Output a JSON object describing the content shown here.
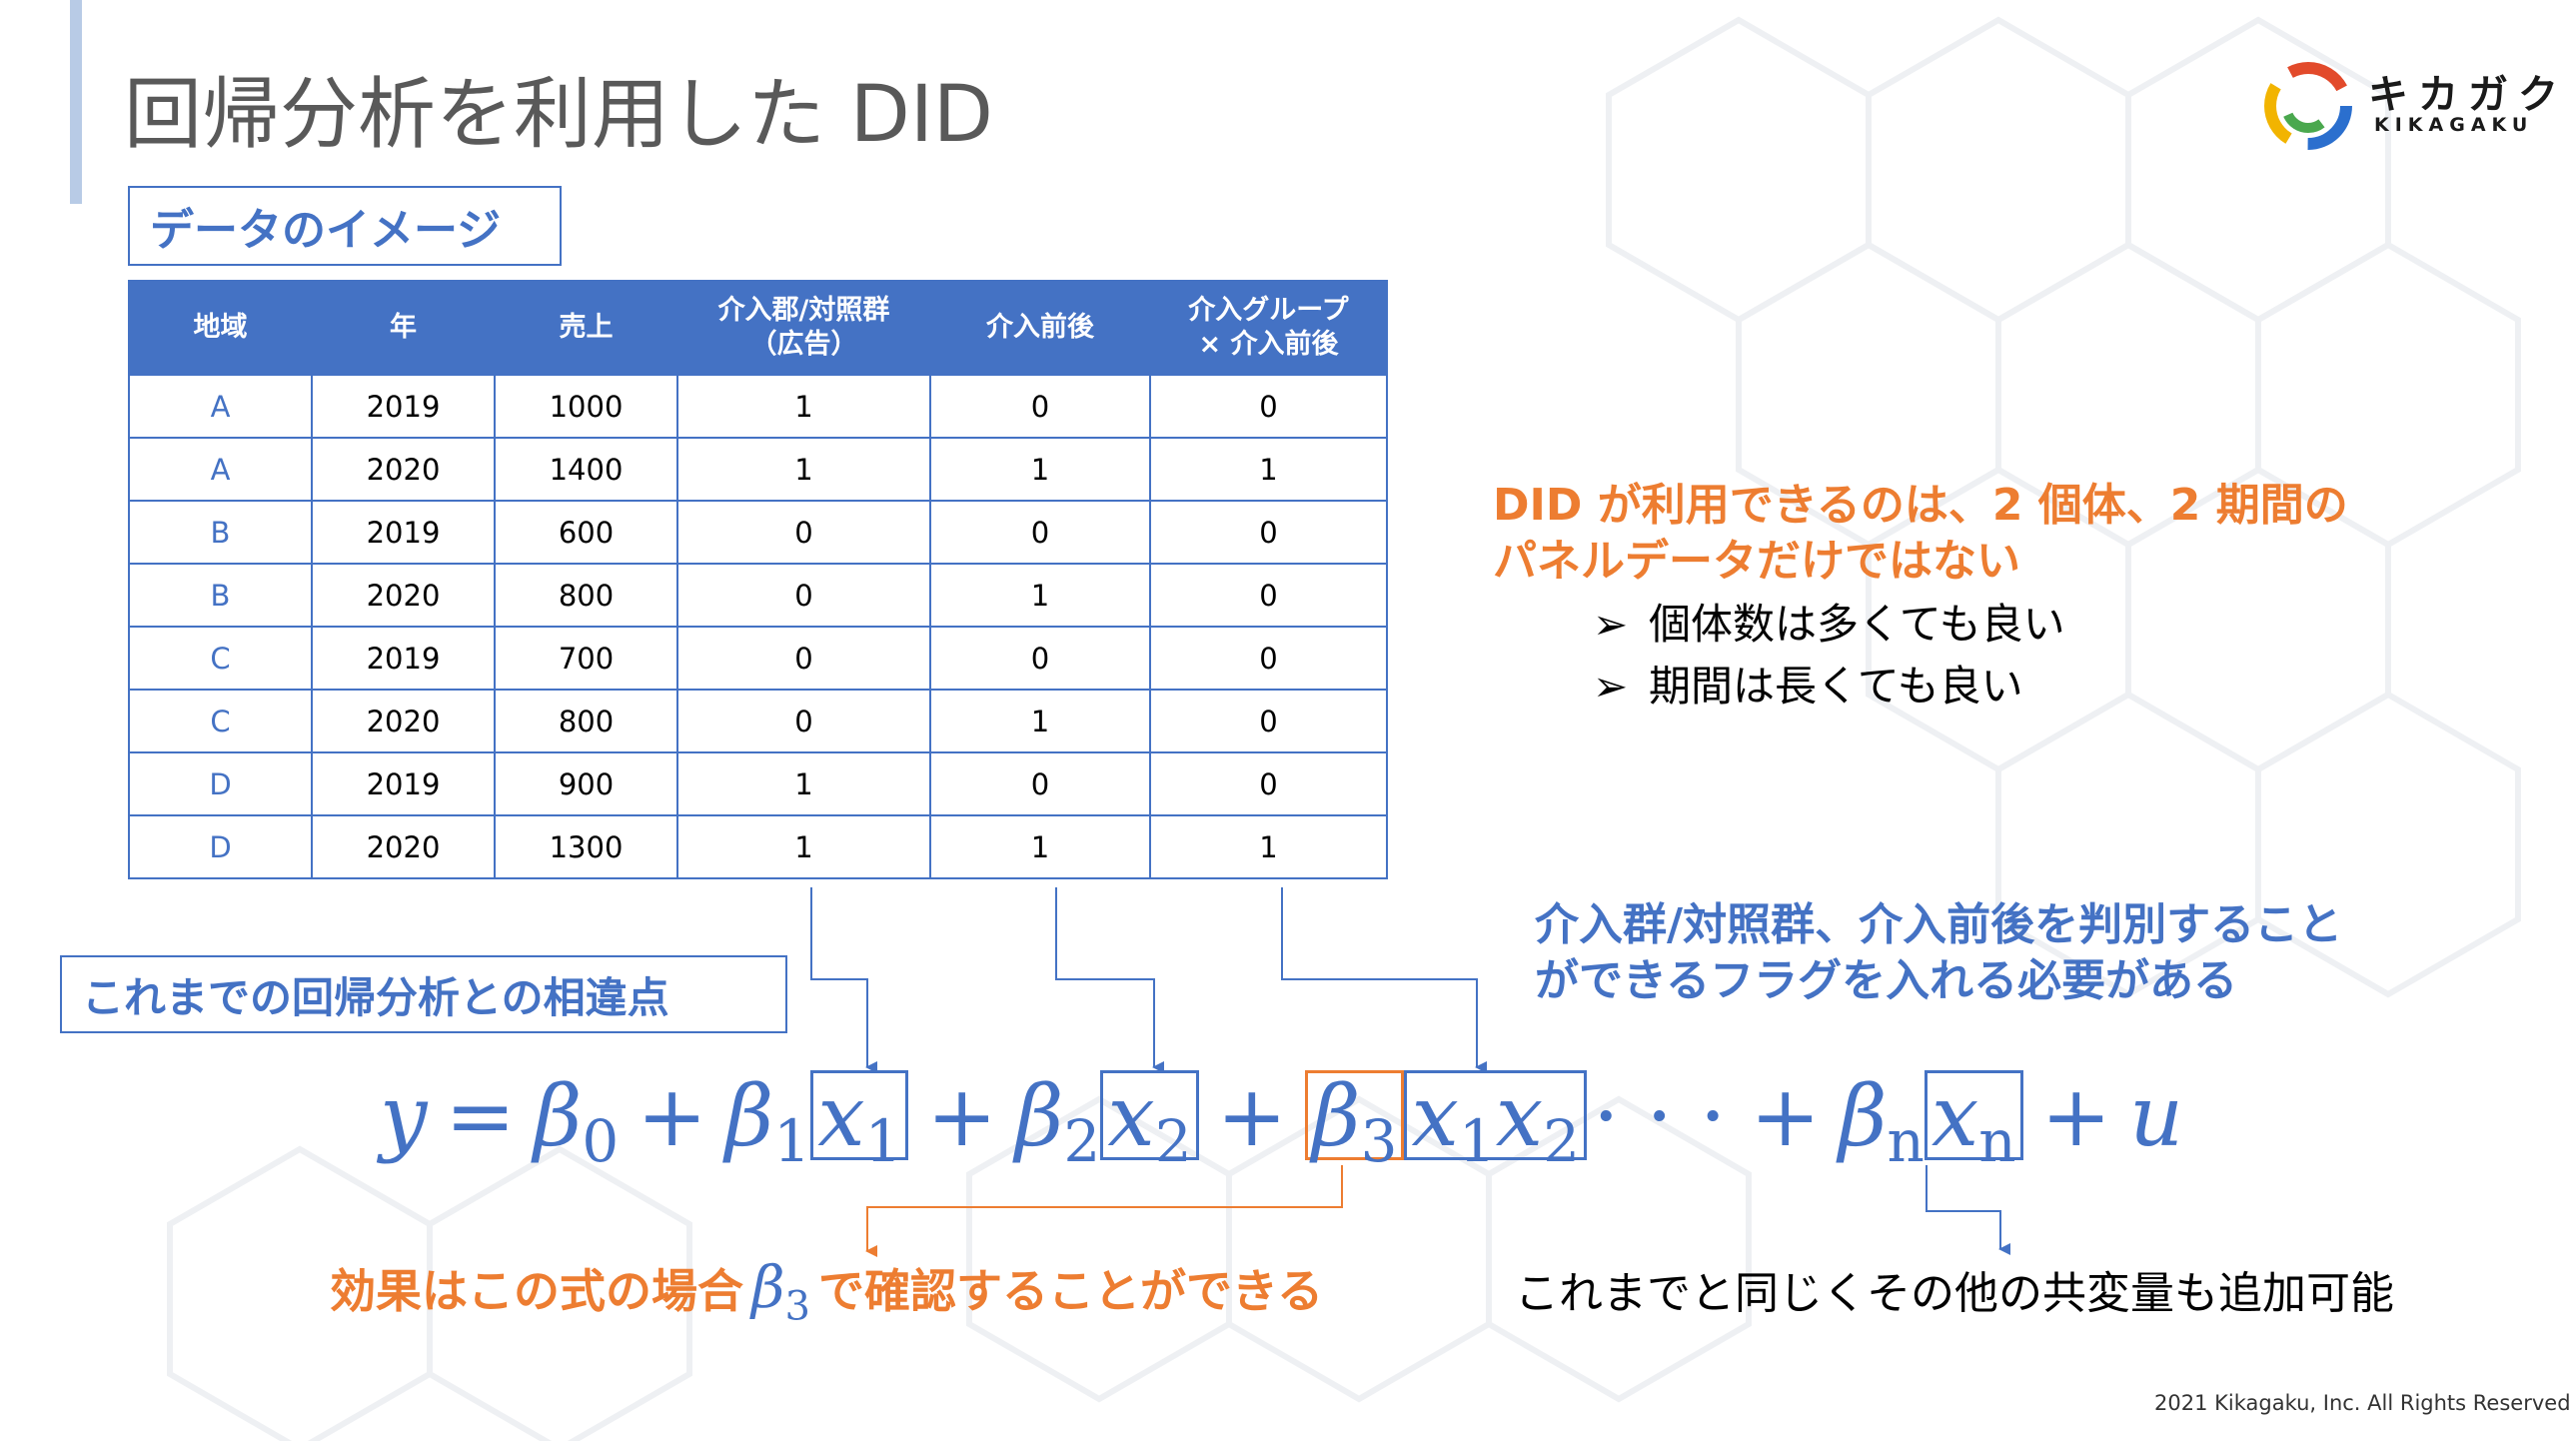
{
  "title": "回帰分析を利用した DID",
  "logo": {
    "jp": "キカガク",
    "en": "KIKAGAKU"
  },
  "data_label": "データのイメージ",
  "table": {
    "headers": [
      "地域",
      "年",
      "売上",
      "介入郡/対照群\n（広告）",
      "介入前後",
      "介入グループ\n× 介入前後"
    ],
    "rows": [
      [
        "A",
        "2019",
        "1000",
        "1",
        "0",
        "0"
      ],
      [
        "A",
        "2020",
        "1400",
        "1",
        "1",
        "1"
      ],
      [
        "B",
        "2019",
        "600",
        "0",
        "0",
        "0"
      ],
      [
        "B",
        "2020",
        "800",
        "0",
        "1",
        "0"
      ],
      [
        "C",
        "2019",
        "700",
        "0",
        "0",
        "0"
      ],
      [
        "C",
        "2020",
        "800",
        "0",
        "1",
        "0"
      ],
      [
        "D",
        "2019",
        "900",
        "1",
        "0",
        "0"
      ],
      [
        "D",
        "2020",
        "1300",
        "1",
        "1",
        "1"
      ]
    ]
  },
  "did_note": {
    "line1": "DID が利用できるのは、2 個体、2 期間の",
    "line2": "パネルデータだけではない",
    "bullet_mark": "➢",
    "bullets": [
      "個体数は多くても良い",
      "期間は長くても良い"
    ]
  },
  "flag_note": {
    "line1": "介入群/対照群、介入前後を判別すること",
    "line2": "ができるフラグを入れる必要がある"
  },
  "diff_label": "これまでの回帰分析との相違点",
  "formula": {
    "y": "y",
    "eq": "=",
    "plus": "+",
    "dots": "· · ·",
    "beta": "β",
    "x": "x",
    "u": "u",
    "s0": "0",
    "s1": "1",
    "s2": "2",
    "s3": "3",
    "sn": "n"
  },
  "effect_note": {
    "before": "効果はこの式の場合",
    "after": "で確認することができる"
  },
  "covariate_note": "これまでと同じくその他の共変量も追加可能",
  "copyright": "2021 Kikagaku, Inc. All Rights Reserved",
  "colors": {
    "blue": "#4472c4",
    "orange": "#ed7d31",
    "title_gray": "#595959"
  }
}
